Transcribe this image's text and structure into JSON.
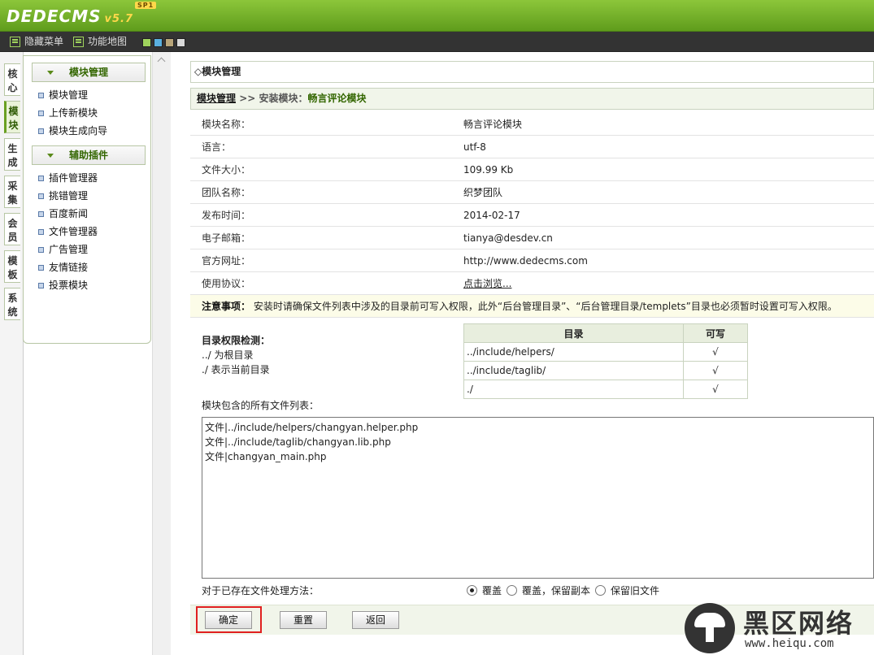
{
  "header": {
    "logo": "DEDECMS",
    "version": "v5.7",
    "edition": "SP1"
  },
  "menubar": {
    "hide_menu": "隐藏菜单",
    "site_map": "功能地图",
    "swatches": [
      "#9fd35d",
      "#5ab0e0",
      "#b9a67a",
      "#d9d9d9"
    ]
  },
  "vtabs": [
    "核心",
    "模块",
    "生成",
    "采集",
    "会员",
    "模板",
    "系统"
  ],
  "sidebar": {
    "groups": [
      {
        "title": "模块管理",
        "items": [
          "模块管理",
          "上传新模块",
          "模块生成向导"
        ]
      },
      {
        "title": "辅助插件",
        "items": [
          "插件管理器",
          "挑错管理",
          "百度新闻",
          "文件管理器",
          "广告管理",
          "友情链接",
          "投票模块"
        ]
      }
    ]
  },
  "main": {
    "title": "◇模块管理",
    "crumb": {
      "link": "模块管理",
      "sep": " >> 安装模块：",
      "current": "畅言评论模块"
    },
    "info": [
      {
        "k": "模块名称：",
        "v": "畅言评论模块"
      },
      {
        "k": "语言：",
        "v": "utf-8"
      },
      {
        "k": "文件大小：",
        "v": "109.99 Kb"
      },
      {
        "k": "团队名称：",
        "v": "织梦团队"
      },
      {
        "k": "发布时间：",
        "v": "2014-02-17"
      },
      {
        "k": "电子邮箱：",
        "v": "tianya@desdev.cn"
      },
      {
        "k": "官方网址：",
        "v": "http://www.dedecms.com"
      },
      {
        "k": "使用协议：",
        "v": "点击浏览..."
      }
    ],
    "notice_label": "注意事项：",
    "notice_text": "安装时请确保文件列表中涉及的目录前可写入权限，此外“后台管理目录”、“后台管理目录/templets”目录也必须暂时设置可写入权限。",
    "perm": {
      "heading": "目录权限检测：",
      "note1": "../ 为根目录",
      "note2": "./ 表示当前目录",
      "col_dir": "目录",
      "col_write": "可写",
      "rows": [
        {
          "dir": "../include/helpers/",
          "w": "√"
        },
        {
          "dir": "../include/taglib/",
          "w": "√"
        },
        {
          "dir": "./",
          "w": "√"
        }
      ]
    },
    "file_label": "模块包含的所有文件列表：",
    "files": [
      "文件|../include/helpers/changyan.helper.php",
      "文件|../include/taglib/changyan.lib.php",
      "文件|changyan_main.php"
    ],
    "exist_label": "对于已存在文件处理方法：",
    "options": [
      "覆盖",
      "覆盖，保留副本",
      "保留旧文件"
    ],
    "buttons": {
      "ok": "确定",
      "reset": "重置",
      "back": "返回"
    }
  },
  "watermark": {
    "brand": "黑区网络",
    "url": "www.heiqu.com"
  }
}
